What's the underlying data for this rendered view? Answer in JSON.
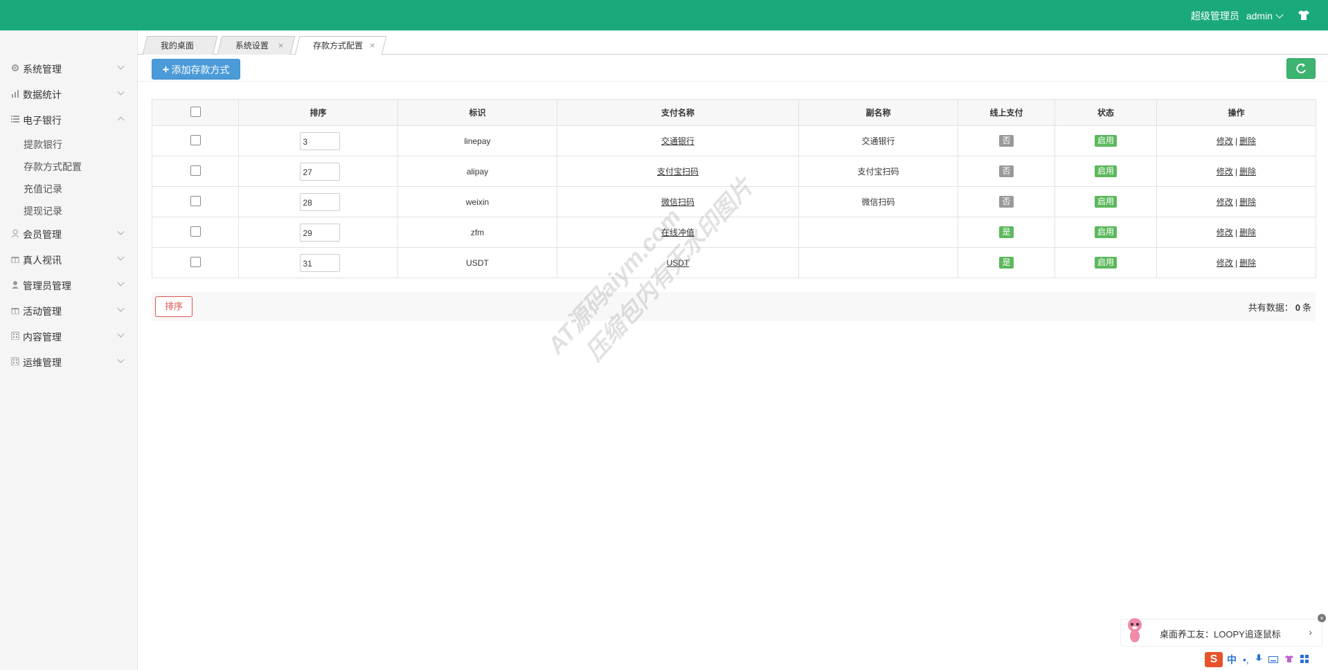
{
  "header": {
    "role": "超级管理员",
    "username": "admin"
  },
  "sidebar": {
    "items": [
      {
        "label": "系统管理",
        "icon": "gear-icon"
      },
      {
        "label": "数据统计",
        "icon": "chart-icon"
      },
      {
        "label": "电子银行",
        "icon": "list-icon",
        "expanded": true,
        "children": [
          "提款银行",
          "存款方式配置",
          "充值记录",
          "提现记录"
        ]
      },
      {
        "label": "会员管理",
        "icon": "user-icon"
      },
      {
        "label": "真人视讯",
        "icon": "gift-icon"
      },
      {
        "label": "管理员管理",
        "icon": "admin-icon"
      },
      {
        "label": "活动管理",
        "icon": "gift-icon"
      },
      {
        "label": "内容管理",
        "icon": "building-icon"
      },
      {
        "label": "运维管理",
        "icon": "building-icon"
      }
    ]
  },
  "tabs": [
    {
      "label": "我的桌面"
    },
    {
      "label": "系统设置",
      "close": "×"
    },
    {
      "label": "存款方式配置",
      "close": "×",
      "active": true
    }
  ],
  "toolbar": {
    "add_label": "添加存款方式"
  },
  "table": {
    "headers": [
      "排序",
      "标识",
      "支付名称",
      "副名称",
      "线上支付",
      "状态",
      "操作"
    ],
    "rows": [
      {
        "sort": "3",
        "code": "linepay",
        "name": "交通银行",
        "subname": "交通银行",
        "online": "否",
        "status": "启用",
        "edit": "修改",
        "del": "删除"
      },
      {
        "sort": "27",
        "code": "alipay",
        "name": "支付宝扫码",
        "subname": "支付宝扫码",
        "online": "否",
        "status": "启用",
        "edit": "修改",
        "del": "删除"
      },
      {
        "sort": "28",
        "code": "weixin",
        "name": "微信扫码",
        "subname": "微信扫码",
        "online": "否",
        "status": "启用",
        "edit": "修改",
        "del": "删除"
      },
      {
        "sort": "29",
        "code": "zfm",
        "name": "在线冲值",
        "subname": "",
        "online": "是",
        "status": "启用",
        "edit": "修改",
        "del": "删除"
      },
      {
        "sort": "31",
        "code": "USDT",
        "name": "USDT",
        "subname": "",
        "online": "是",
        "status": "启用",
        "edit": "修改",
        "del": "删除"
      }
    ],
    "separator": "|"
  },
  "footer": {
    "sort_button": "排序",
    "total_prefix": "共有数据：",
    "total_count": "0",
    "total_suffix": "条"
  },
  "watermark": {
    "line1": "AT源码aiym.com",
    "line2": "压缩包内有无水印图片"
  },
  "notification": {
    "text": "桌面养工友：LOOPY追逐鼠标",
    "chevron": "›",
    "close": "×"
  },
  "ime": {
    "logo": "S",
    "lang": "中",
    "punct": "•,",
    "icons": [
      "mic-icon",
      "keyboard-icon",
      "shirt-icon",
      "grid-icon"
    ]
  },
  "colors": {
    "topbar": "#1aa97b",
    "primary": "#4b9bd8",
    "success": "#5cb85c",
    "danger": "#d9534f",
    "muted": "#999999"
  }
}
